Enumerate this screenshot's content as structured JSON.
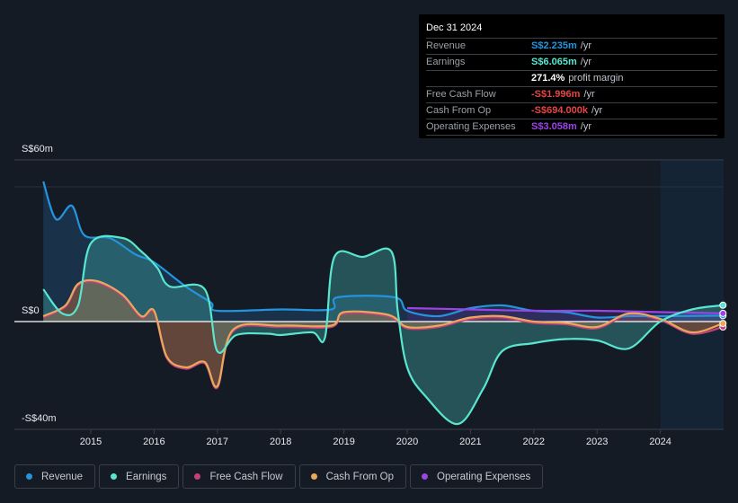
{
  "tooltip": {
    "date": "Dec 31 2024",
    "rows": [
      {
        "label": "Revenue",
        "value": "S$2.235m",
        "unit": "/yr",
        "color": "#2394df"
      },
      {
        "label": "Earnings",
        "value": "S$6.065m",
        "unit": "/yr",
        "color": "#58e6cf"
      },
      {
        "label": "",
        "value": "271.4%",
        "unit": "profit margin",
        "color": "#ffffff"
      },
      {
        "label": "Free Cash Flow",
        "value": "-S$1.996m",
        "unit": "/yr",
        "color": "#e64545"
      },
      {
        "label": "Cash From Op",
        "value": "-S$694.000k",
        "unit": "/yr",
        "color": "#e64545"
      },
      {
        "label": "Operating Expenses",
        "value": "S$3.058m",
        "unit": "/yr",
        "color": "#9b45e6"
      }
    ]
  },
  "legend": [
    {
      "label": "Revenue",
      "color": "#2394df"
    },
    {
      "label": "Earnings",
      "color": "#58e6cf"
    },
    {
      "label": "Free Cash Flow",
      "color": "#c4407d"
    },
    {
      "label": "Cash From Op",
      "color": "#e8a95b"
    },
    {
      "label": "Operating Expenses",
      "color": "#9b45e6"
    }
  ],
  "chart_data": {
    "type": "area",
    "title": "",
    "xlabel": "",
    "ylabel": "",
    "ylim": [
      -40,
      60
    ],
    "xlim": [
      2014.25,
      2024.99
    ],
    "y_tick_labels": [
      "S$60m",
      "S$0",
      "-S$40m"
    ],
    "x_tick_labels": [
      "2015",
      "2016",
      "2017",
      "2018",
      "2019",
      "2020",
      "2021",
      "2022",
      "2023",
      "2024"
    ],
    "x_ticks": [
      2015,
      2016,
      2017,
      2018,
      2019,
      2020,
      2021,
      2022,
      2023,
      2024
    ],
    "highlight_from": 2024.0,
    "grid": true,
    "legend_position": "bottom",
    "series": [
      {
        "name": "Revenue",
        "color": "#2394df",
        "points": [
          [
            2014.25,
            52
          ],
          [
            2014.45,
            38
          ],
          [
            2014.7,
            43
          ],
          [
            2014.9,
            32
          ],
          [
            2015.3,
            31
          ],
          [
            2015.7,
            25
          ],
          [
            2016.0,
            22
          ],
          [
            2016.5,
            13
          ],
          [
            2016.9,
            7
          ],
          [
            2017.0,
            4
          ],
          [
            2018.0,
            4.5
          ],
          [
            2018.8,
            4.5
          ],
          [
            2018.9,
            9
          ],
          [
            2019.8,
            9
          ],
          [
            2020.0,
            4
          ],
          [
            2020.5,
            2
          ],
          [
            2021.0,
            5
          ],
          [
            2021.5,
            6
          ],
          [
            2022.0,
            4
          ],
          [
            2022.5,
            3.5
          ],
          [
            2023.0,
            1.5
          ],
          [
            2023.5,
            2
          ],
          [
            2024.0,
            2
          ],
          [
            2024.99,
            2.2
          ]
        ]
      },
      {
        "name": "Earnings",
        "color": "#58e6cf",
        "points": [
          [
            2014.25,
            12
          ],
          [
            2014.55,
            3
          ],
          [
            2014.8,
            6
          ],
          [
            2015.0,
            29
          ],
          [
            2015.5,
            31
          ],
          [
            2015.8,
            26
          ],
          [
            2016.05,
            20
          ],
          [
            2016.25,
            13
          ],
          [
            2016.8,
            12
          ],
          [
            2017.0,
            -11
          ],
          [
            2017.3,
            -5
          ],
          [
            2017.8,
            -4.5
          ],
          [
            2018.0,
            -5
          ],
          [
            2018.5,
            -4
          ],
          [
            2018.7,
            -6
          ],
          [
            2018.85,
            24
          ],
          [
            2019.3,
            24
          ],
          [
            2019.75,
            26
          ],
          [
            2019.85,
            4
          ],
          [
            2020.0,
            -17
          ],
          [
            2020.3,
            -28
          ],
          [
            2020.8,
            -38
          ],
          [
            2021.2,
            -25
          ],
          [
            2021.5,
            -11
          ],
          [
            2022.0,
            -8
          ],
          [
            2022.5,
            -6.5
          ],
          [
            2023.0,
            -7
          ],
          [
            2023.5,
            -10
          ],
          [
            2024.0,
            0
          ],
          [
            2024.5,
            4.5
          ],
          [
            2024.99,
            6.065
          ]
        ]
      },
      {
        "name": "Free Cash Flow",
        "color": "#c4407d",
        "points": [
          [
            2014.25,
            1.5
          ],
          [
            2014.6,
            5.5
          ],
          [
            2014.8,
            13.5
          ],
          [
            2015.1,
            14.5
          ],
          [
            2015.5,
            9.5
          ],
          [
            2015.8,
            1.5
          ],
          [
            2016.0,
            3.5
          ],
          [
            2016.2,
            -13.5
          ],
          [
            2016.5,
            -17.5
          ],
          [
            2016.8,
            -15.5
          ],
          [
            2017.0,
            -24.5
          ],
          [
            2017.25,
            -3.5
          ],
          [
            2018.0,
            -2
          ],
          [
            2018.8,
            -2
          ],
          [
            2019.0,
            3
          ],
          [
            2019.7,
            2
          ],
          [
            2020.0,
            -2.5
          ],
          [
            2020.5,
            -2
          ],
          [
            2021.0,
            1
          ],
          [
            2021.5,
            1.5
          ],
          [
            2022.0,
            -0.5
          ],
          [
            2022.5,
            -1
          ],
          [
            2023.0,
            -2.5
          ],
          [
            2023.5,
            2.5
          ],
          [
            2024.0,
            0.5
          ],
          [
            2024.5,
            -4.5
          ],
          [
            2024.99,
            -2
          ]
        ]
      },
      {
        "name": "Cash From Op",
        "color": "#e8a95b",
        "points": [
          [
            2014.25,
            2
          ],
          [
            2014.6,
            6
          ],
          [
            2014.8,
            14
          ],
          [
            2015.1,
            15
          ],
          [
            2015.5,
            10
          ],
          [
            2015.8,
            2
          ],
          [
            2016.0,
            4
          ],
          [
            2016.2,
            -13
          ],
          [
            2016.5,
            -17
          ],
          [
            2016.8,
            -15
          ],
          [
            2017.0,
            -24
          ],
          [
            2017.25,
            -3
          ],
          [
            2018.0,
            -1.5
          ],
          [
            2018.8,
            -1.5
          ],
          [
            2019.0,
            3.5
          ],
          [
            2019.7,
            2.5
          ],
          [
            2020.0,
            -2
          ],
          [
            2020.5,
            -1.5
          ],
          [
            2021.0,
            1.5
          ],
          [
            2021.5,
            2
          ],
          [
            2022.0,
            0
          ],
          [
            2022.5,
            -0.5
          ],
          [
            2023.0,
            -2
          ],
          [
            2023.5,
            3
          ],
          [
            2024.0,
            1
          ],
          [
            2024.5,
            -4
          ],
          [
            2024.99,
            -0.694
          ]
        ]
      },
      {
        "name": "Operating Expenses",
        "color": "#9b45e6",
        "points": [
          [
            2020.0,
            5
          ],
          [
            2021.0,
            4.5
          ],
          [
            2022.0,
            4
          ],
          [
            2023.0,
            4
          ],
          [
            2024.0,
            3.5
          ],
          [
            2024.99,
            3.058
          ]
        ]
      }
    ]
  }
}
